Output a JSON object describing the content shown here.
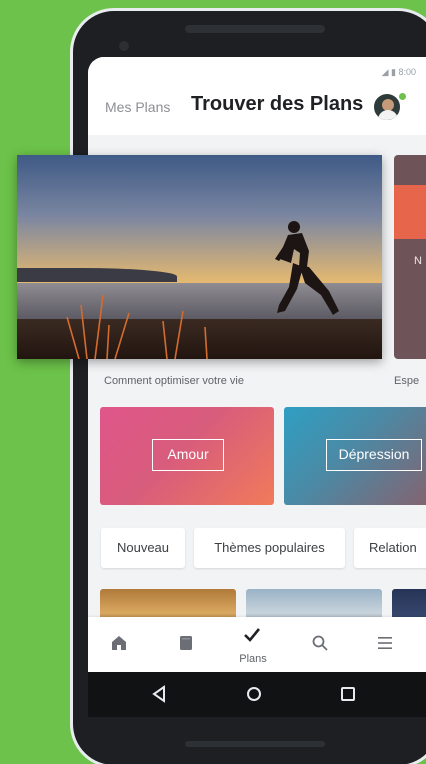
{
  "app": {
    "header": {
      "tab_my_plans": "Mes Plans",
      "tab_find_plans": "Trouver des Plans"
    },
    "status_bar": {
      "time": "8:00"
    },
    "featured": [
      {
        "caption": "Comment optimiser votre vie"
      },
      {
        "caption": "Espe"
      }
    ],
    "topics": [
      {
        "label": "Amour"
      },
      {
        "label": "Dépression"
      }
    ],
    "filters": [
      {
        "label": "Nouveau"
      },
      {
        "label": "Thèmes populaires"
      },
      {
        "label": "Relation"
      }
    ],
    "bottom_nav": {
      "active_label": "Plans",
      "items": [
        "home-icon",
        "book-icon",
        "check-icon",
        "search-icon",
        "menu-icon"
      ]
    },
    "colors": {
      "background": "#6cc24a",
      "accent_green": "#6cc24a",
      "text_primary": "#202124"
    }
  }
}
